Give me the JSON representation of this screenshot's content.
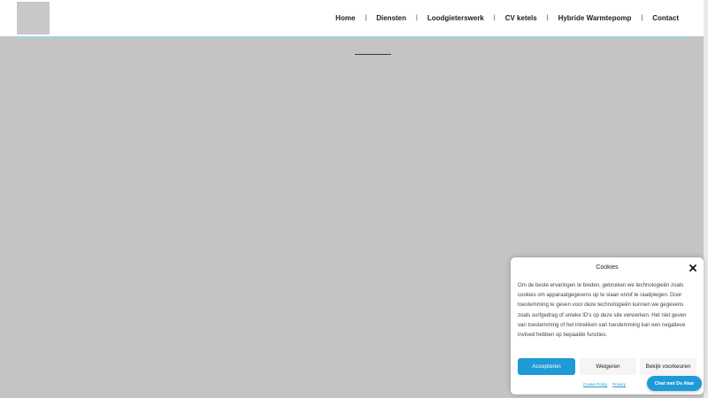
{
  "nav": {
    "items": [
      {
        "label": "Home"
      },
      {
        "label": "Diensten"
      },
      {
        "label": "Loodgieterswerk"
      },
      {
        "label": "CV ketels"
      },
      {
        "label": "Hybride Warmtepomp"
      },
      {
        "label": "Contact"
      }
    ],
    "separator": "|"
  },
  "cookie": {
    "title": "Cookies",
    "close_icon": "close-icon",
    "text": "Om de beste ervaringen te bieden, gebruiken we technologieën zoals cookies om apparaatgegevens op te slaan en/of te raadplegen. Door toestemming te geven voor deze technologieën kunnen we gegevens zoals surfgedrag of unieke ID's op deze site verwerken. Het niet geven van toestemming of het intrekken van toestemming kan een negatieve invloed hebben op bepaalde functies.",
    "accept_label": "Accepteren",
    "deny_label": "Weigeren",
    "preferences_label": "Bekijk voorkeuren",
    "links": {
      "cookie_policy": "Cookie Policy",
      "privacy": "Privacy"
    }
  },
  "chat": {
    "label": "Chat met De Akar"
  },
  "colors": {
    "accent": "#1e9ad6",
    "header_line": "#9fd3dc",
    "background": "#c4c4c4"
  }
}
